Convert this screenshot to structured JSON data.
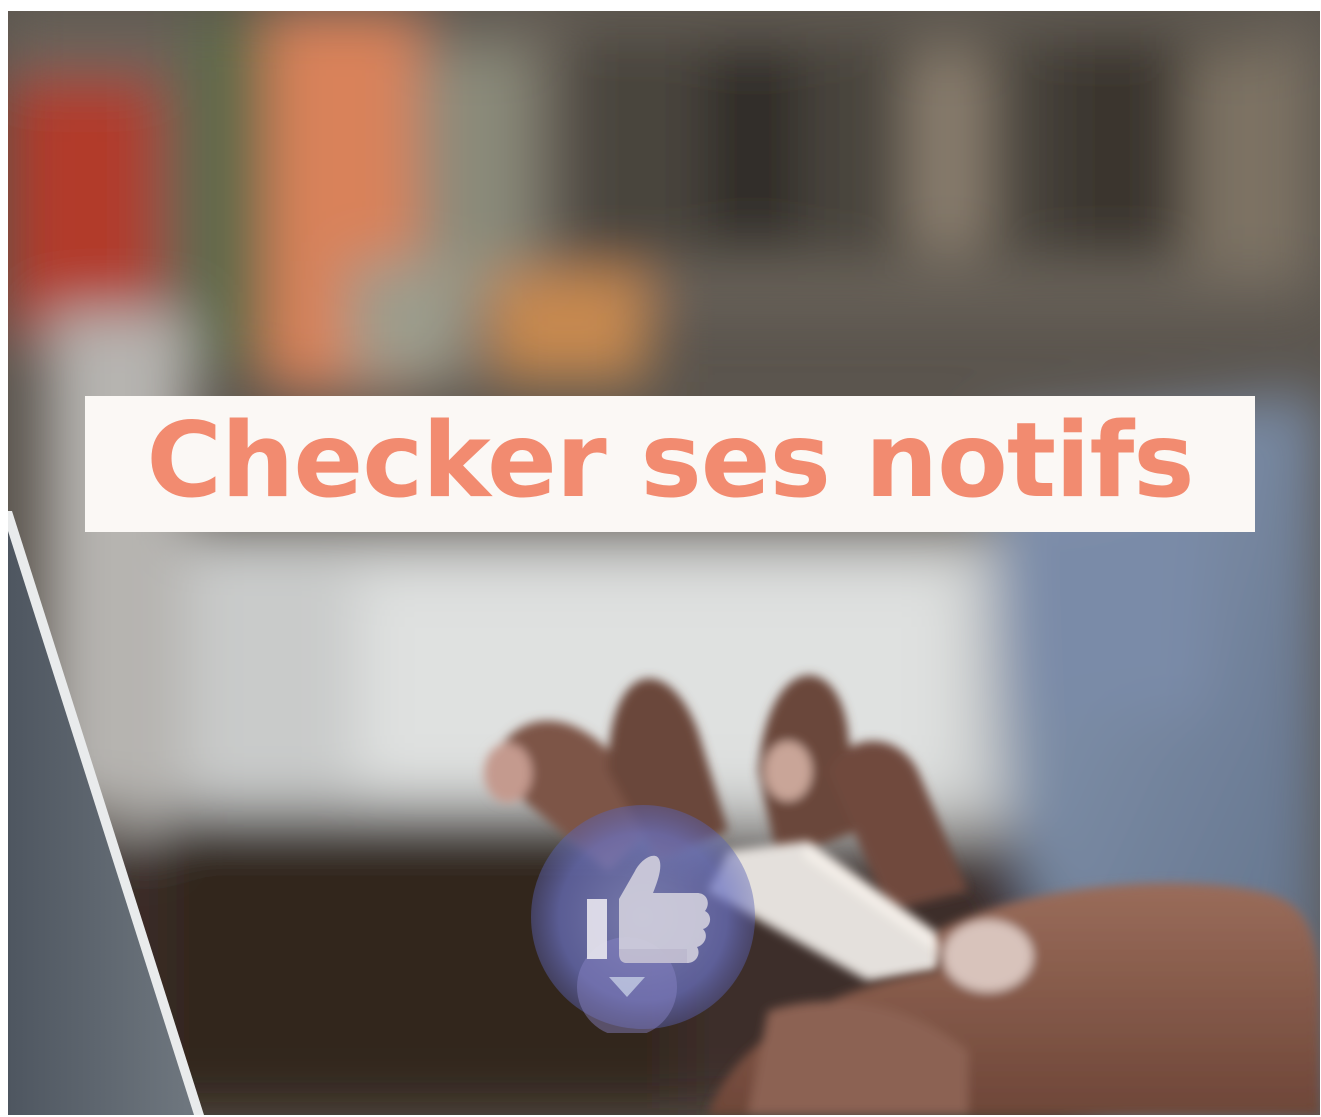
{
  "caption": {
    "text": "Checker ses notifs"
  },
  "scene": {
    "description_icon": "thumbs-up-icon",
    "colors": {
      "caption_text": "#f28b70",
      "caption_background": "#fbf8f5",
      "badge_blue": "#6a74c8"
    }
  }
}
